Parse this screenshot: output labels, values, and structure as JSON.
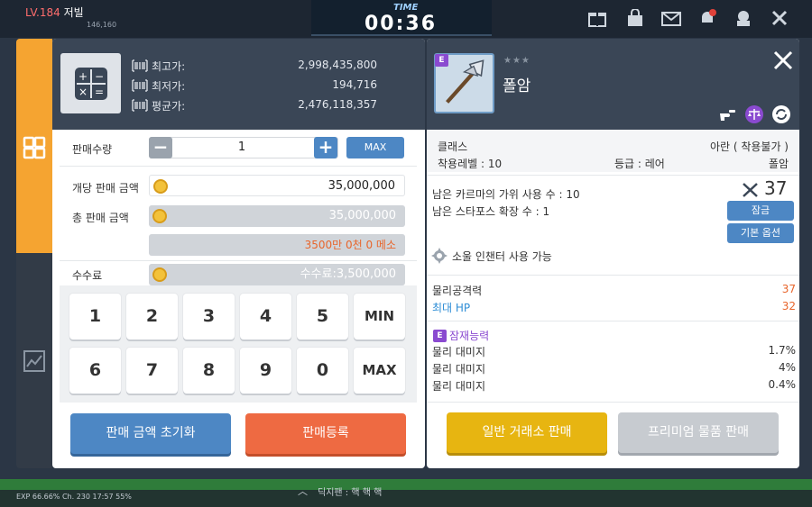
{
  "hud": {
    "level": "LV.184",
    "player_name": "저빌",
    "exp_mini": "146,160",
    "time_label": "TIME",
    "time_value": "00:36",
    "status_text": "EXP 66.66% Ch. 230 17:57 55%",
    "chat_text": "딕지팬 : 핵 핵 핵",
    "notification_count": "7"
  },
  "price_info": {
    "highest_label": "최고가:",
    "highest_value": "2,998,435,800",
    "lowest_label": "최저가:",
    "lowest_value": "194,716",
    "average_label": "평균가:",
    "average_value": "2,476,118,357"
  },
  "sell_form": {
    "quantity_label": "판매수량",
    "quantity_value": "1",
    "max_label": "MAX",
    "unit_price_label": "개당 판매 금액",
    "unit_price_value": "35,000,000",
    "total_price_label": "총 판매 금액",
    "total_price_value": "35,000,000",
    "total_price_korean": "3500만 0천 0 메소",
    "fee_label": "수수료",
    "fee_value": "수수료:3,500,000"
  },
  "keypad": {
    "row1": [
      "1",
      "2",
      "3",
      "4",
      "5",
      "MIN"
    ],
    "row2": [
      "6",
      "7",
      "8",
      "9",
      "0",
      "MAX"
    ]
  },
  "buttons": {
    "reset_label": "판매 금액 초기화",
    "register_label": "판매등록",
    "general_sell_label": "일반 거래소 판매",
    "premium_sell_label": "프리미엄 물품 판매"
  },
  "item": {
    "grade_badge": "E",
    "stars": "★★★",
    "name": "폴암",
    "class_label": "클래스",
    "class_value": "아란 ( 착용불가 )",
    "req_level_label": "착용레벨 : 10",
    "rank_label": "등급 : 레어",
    "type_value": "폴암",
    "scissors_label": "남은 카르마의 가위 사용 수 : 10",
    "starforce_label": "남은 스타포스 확장 수 : 1",
    "power_value": "37",
    "lock_button": "잠금",
    "base_option_button": "기본 옵션",
    "soul_label": "소울 인챈터 사용 가능",
    "stats": [
      {
        "name": "물리공격력",
        "value": "37"
      },
      {
        "name": "최대 HP",
        "value": "32"
      }
    ],
    "potential_badge": "E",
    "potential_label": "잠재능력",
    "potentials": [
      {
        "name": "물리 대미지",
        "value": "1.7%"
      },
      {
        "name": "물리 대미지",
        "value": "4%"
      },
      {
        "name": "물리 대미지",
        "value": "0.4%"
      }
    ]
  },
  "colors": {
    "accent_orange": "#f5a431",
    "button_blue": "#4d87c4",
    "button_orange": "#ee6a42",
    "button_yellow": "#e7b511",
    "header_dark": "#3a4656"
  }
}
